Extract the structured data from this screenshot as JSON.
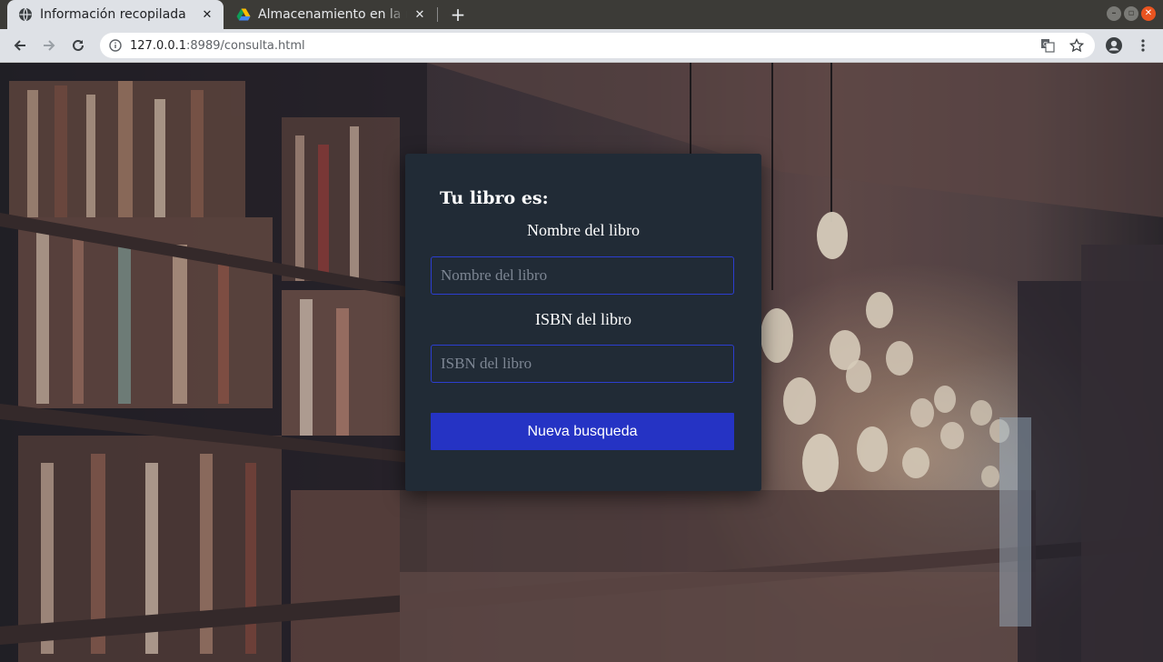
{
  "browser": {
    "tabs": [
      {
        "title": "Información recopilada",
        "active": true,
        "icon": "globe-icon"
      },
      {
        "title": "Almacenamiento en la nube",
        "active": false,
        "icon": "google-drive-icon"
      }
    ],
    "url_host": "127.0.0.1",
    "url_rest": ":8989/consulta.html"
  },
  "form": {
    "heading": "Tu libro es:",
    "name_label": "Nombre del libro",
    "name_placeholder": "Nombre del libro",
    "isbn_label": "ISBN del libro",
    "isbn_placeholder": "ISBN del libro",
    "button_label": "Nueva busqueda"
  },
  "colors": {
    "card_bg": "#212b36",
    "input_border": "#2c3ed0",
    "button_bg": "#2533c4",
    "tab_close": "#e95420"
  }
}
